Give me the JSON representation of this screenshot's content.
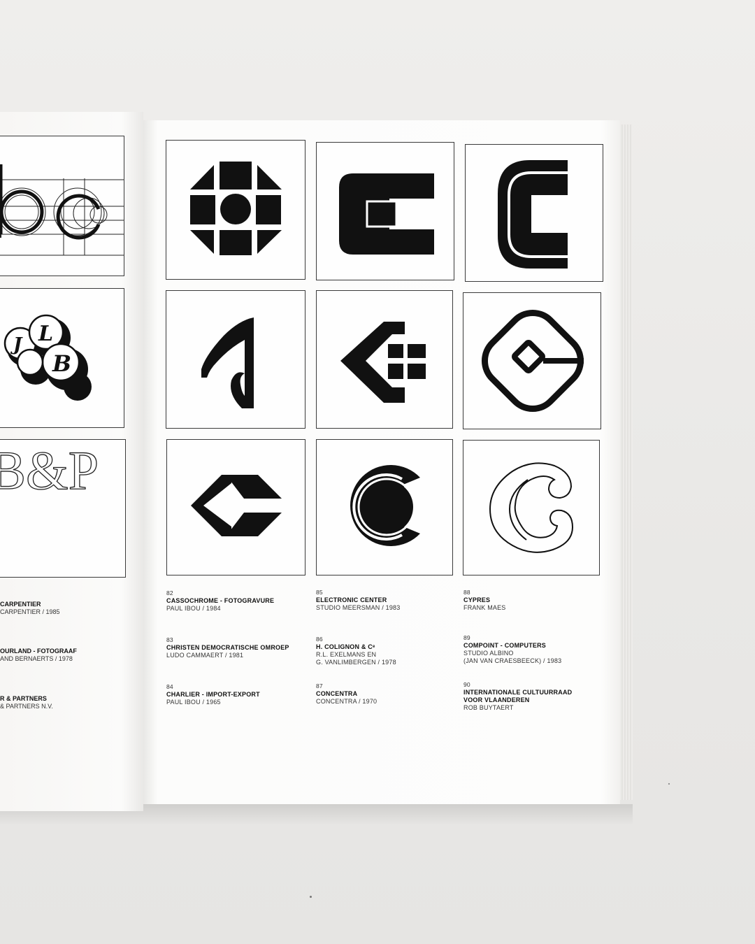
{
  "left_page": {
    "partial_logo_text": "B&P",
    "captions": [
      {
        "title": "CARPENTIER",
        "author": "CARPENTIER / 1985"
      },
      {
        "title": "OURLAND - FOTOGRAAF",
        "author": "AND BERNAERTS / 1978"
      },
      {
        "title": "R & PARTNERS",
        "author": "& PARTNERS N.V."
      }
    ]
  },
  "right_page": {
    "columns": [
      [
        {
          "number": "82",
          "title": "CASSOCHROME - FOTOGRAVURE",
          "author": [
            "PAUL IBOU / 1984"
          ]
        },
        {
          "number": "83",
          "title": "CHRISTEN DEMOCRATISCHE OMROEP",
          "author": [
            "LUDO CAMMAERT / 1981"
          ]
        },
        {
          "number": "84",
          "title": "CHARLIER - IMPORT-EXPORT",
          "author": [
            "PAUL IBOU / 1965"
          ]
        }
      ],
      [
        {
          "number": "85",
          "title": "ELECTRONIC CENTER",
          "author": [
            "STUDIO MEERSMAN / 1983"
          ]
        },
        {
          "number": "86",
          "title": "H. COLIGNON & Cᵉ",
          "author": [
            "R.L. EXELMANS EN",
            "G. VANLIMBERGEN / 1978"
          ]
        },
        {
          "number": "87",
          "title": "CONCENTRA",
          "author": [
            "CONCENTRA / 1970"
          ]
        }
      ],
      [
        {
          "number": "88",
          "title": "CYPRES",
          "author": [
            "FRANK MAES"
          ]
        },
        {
          "number": "89",
          "title": "COMPOINT - COMPUTERS",
          "author": [
            "STUDIO ALBINO",
            "(JAN VAN CRAESBEECK) / 1983"
          ]
        },
        {
          "number": "90",
          "title": "INTERNATIONALE CULTUURRAAD",
          "title2": "VOOR VLAANDEREN",
          "author": [
            "ROB BUYTAERT"
          ]
        }
      ]
    ]
  },
  "colors": {
    "ink": "#1a1a1a",
    "paper": "#fdfdfc",
    "background": "#ecebe9"
  }
}
